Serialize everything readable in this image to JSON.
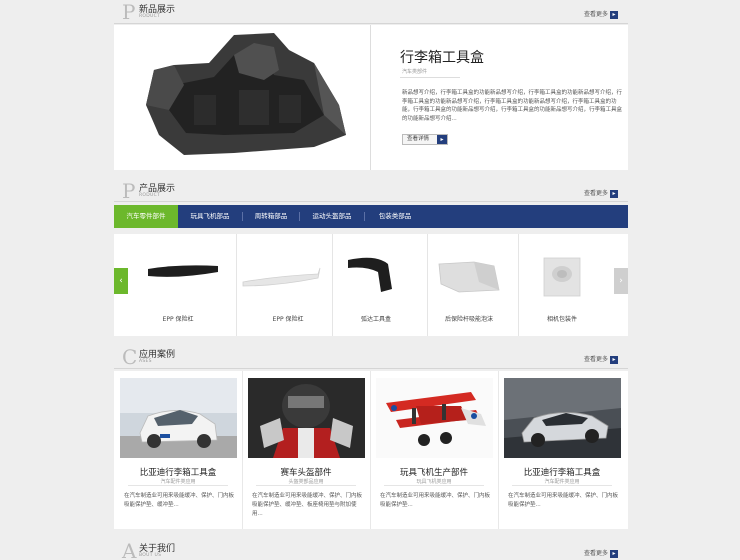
{
  "new_products": {
    "letter": "P",
    "title": "新品展示",
    "subtitle": "RODUCT",
    "more_label": "查看更多",
    "product_title": "行李箱工具盒",
    "product_category": "汽车类部件",
    "product_desc": "新品想写介绍，行李箱工具盒的功能新品想写介绍，行李箱工具盒的功能新品想写介绍，行李箱工具盒的功能新品想写介绍，行李箱工具盒的功能新品想写介绍，行李箱工具盒的功能，行李箱工具盒的功能新品想写介绍，行李箱工具盒的功能新品想写介绍，行李箱工具盒的功能新品想写介绍...",
    "detail_label": "查看详情"
  },
  "products": {
    "letter": "P",
    "title": "产品展示",
    "subtitle": "RODUCT",
    "more_label": "查看更多",
    "tabs": [
      "汽车零件部件",
      "玩具飞机部品",
      "周转箱部品",
      "运动头盔部品",
      "包装类部品"
    ],
    "items": [
      "EPP 保险杠",
      "EPP 保险杠",
      "弧达工具盒",
      "后保险杆吸能泡沫",
      "相机包装件"
    ]
  },
  "cases": {
    "letter": "C",
    "title": "应用案例",
    "subtitle": "ASES",
    "more_label": "查看更多",
    "items": [
      {
        "title": "比亚迪行李箱工具盒",
        "sub": "汽车配件类应用",
        "desc": "在汽车制造业可用来吸能缓冲、保护、门内板吸能保护垫、缓冲垫..."
      },
      {
        "title": "赛车头盔部件",
        "sub": "头盔类部品应用",
        "desc": "在汽车制造业可用来吸能缓冲、保护、门内板吸能保护垫、缓冲垫、板座椅用垫与附加使用..."
      },
      {
        "title": "玩具飞机生产部件",
        "sub": "玩具飞机类应用",
        "desc": "在汽车制造业可用来吸能缓冲、保护、门内板吸能保护垫..."
      },
      {
        "title": "比亚迪行李箱工具盒",
        "sub": "汽车配件类应用",
        "desc": "在汽车制造业可用来吸能缓冲、保护、门内板吸能保护垫..."
      }
    ]
  },
  "about": {
    "letter": "A",
    "title": "关于我们",
    "subtitle": "BOUT US",
    "more_label": "查看更多"
  },
  "colors": {
    "navy": "#233e7d",
    "green": "#6cb82c",
    "background": "#eeeeee"
  }
}
